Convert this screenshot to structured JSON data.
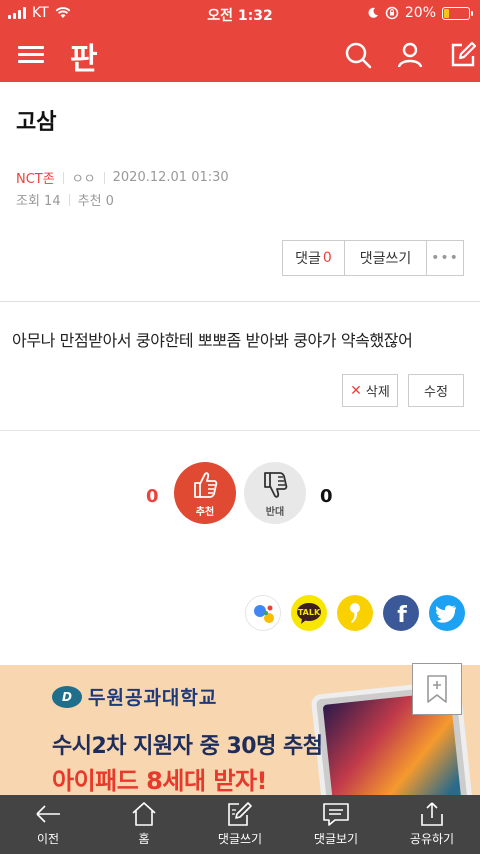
{
  "status_bar": {
    "carrier": "KT",
    "time": "오전 1:32",
    "battery": "20%",
    "battery_level_percent": 20
  },
  "app_bar": {
    "logo": "판",
    "icons": [
      "menu-icon",
      "search-icon",
      "user-icon",
      "compose-icon"
    ]
  },
  "post": {
    "title": "고삼",
    "author": "NCT존",
    "author_extra": "ㅇㅇ",
    "date": "2020.12.01 01:30",
    "views_label": "조회 14",
    "recommend_label": "추천 0",
    "body": "아무나 만점받아서 쿵야한테 뽀뽀좀 받아봐 쿵야가 약속했잖어"
  },
  "actions": {
    "comment_label": "댓글",
    "comment_count": "0",
    "write_comment": "댓글쓰기",
    "more": "•••",
    "delete": "삭제",
    "edit": "수정"
  },
  "vote": {
    "up_count": "0",
    "up_label": "추천",
    "down_count": "0",
    "down_label": "반대"
  },
  "share": {
    "kakaotalk_text": "TALK",
    "facebook_text": "f"
  },
  "banner": {
    "university": "두원공과대학교",
    "logo_mark": "D",
    "line1": "수시2차 지원자 중 30명 추첨",
    "line2": "아이패드 8세대 받자!"
  },
  "bottom_nav": {
    "items": [
      {
        "label": "이전"
      },
      {
        "label": "홈"
      },
      {
        "label": "댓글쓰기"
      },
      {
        "label": "댓글보기"
      },
      {
        "label": "공유하기"
      }
    ]
  },
  "colors": {
    "brand": "#e8453c",
    "nav_bg": "#444444",
    "banner_bg": "#f7d6b0"
  }
}
